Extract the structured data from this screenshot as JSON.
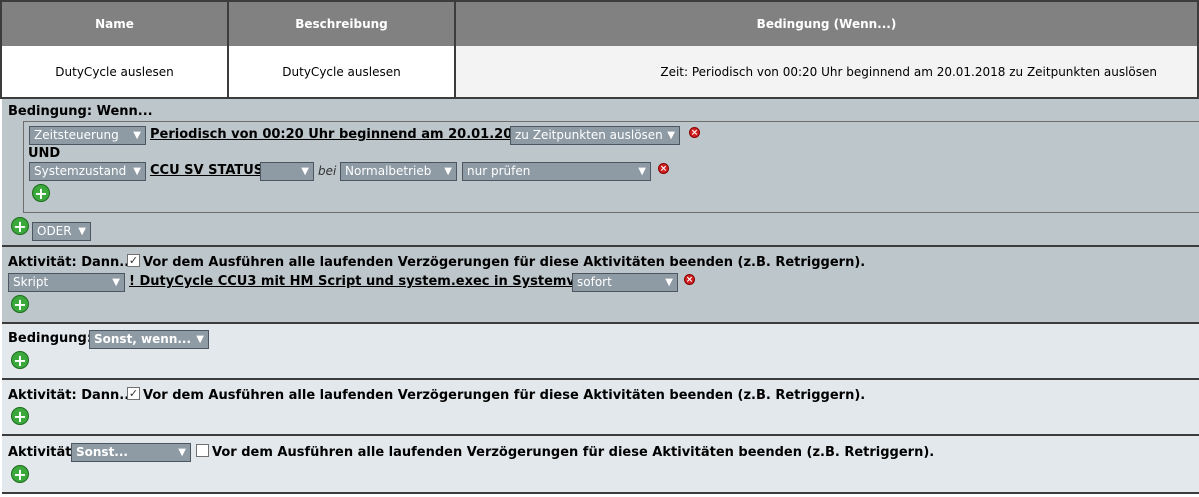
{
  "table": {
    "headers": [
      "Name",
      "Beschreibung",
      "Bedingung (Wenn...)"
    ],
    "name": "DutyCycle auslesen",
    "description": "DutyCycle auslesen",
    "condition_summary": "Zeit: Periodisch von 00:20 Uhr beginnend am 20.01.2018 zu Zeitpunkten auslösen"
  },
  "cond1": {
    "label": "Bedingung: Wenn...",
    "row1": {
      "type_select": "Zeitsteuerung",
      "time_link": "Periodisch von 00:20 Uhr beginnend am 20.01.2018",
      "trigger_select": "zu Zeitpunkten auslösen"
    },
    "und": "UND",
    "row2": {
      "type_select": "Systemzustand",
      "var_link": "CCU SV STATUS",
      "op_select": "",
      "bei": "bei",
      "value_select": "Normalbetrieb",
      "check_select": "nur prüfen"
    },
    "oder_select": "ODER"
  },
  "act1": {
    "label": "Aktivität: Dann...",
    "retrigger": "Vor dem Ausführen alle laufenden Verzögerungen für diese Aktivitäten beenden (z.B. Retriggern).",
    "retrigger_checked": true,
    "type_select": "Skript",
    "script_link": "! DutyCycle CCU3 mit HM Script und system.exec in Systemvari...",
    "timing_select": "sofort"
  },
  "cond2": {
    "label": "Bedingung:",
    "select": "Sonst, wenn..."
  },
  "act2": {
    "label": "Aktivität: Dann...",
    "retrigger": "Vor dem Ausführen alle laufenden Verzögerungen für diese Aktivitäten beenden (z.B. Retriggern).",
    "retrigger_checked": true
  },
  "act3": {
    "label": "Aktivität:",
    "select": "Sonst...",
    "retrigger": "Vor dem Ausführen alle laufenden Verzögerungen für diese Aktivitäten beenden (z.B. Retriggern).",
    "retrigger_checked": false
  },
  "icons": {
    "add": "plus-icon",
    "delete": "delete-icon",
    "dropdown": "chevron-down-icon",
    "check": "check-icon"
  }
}
